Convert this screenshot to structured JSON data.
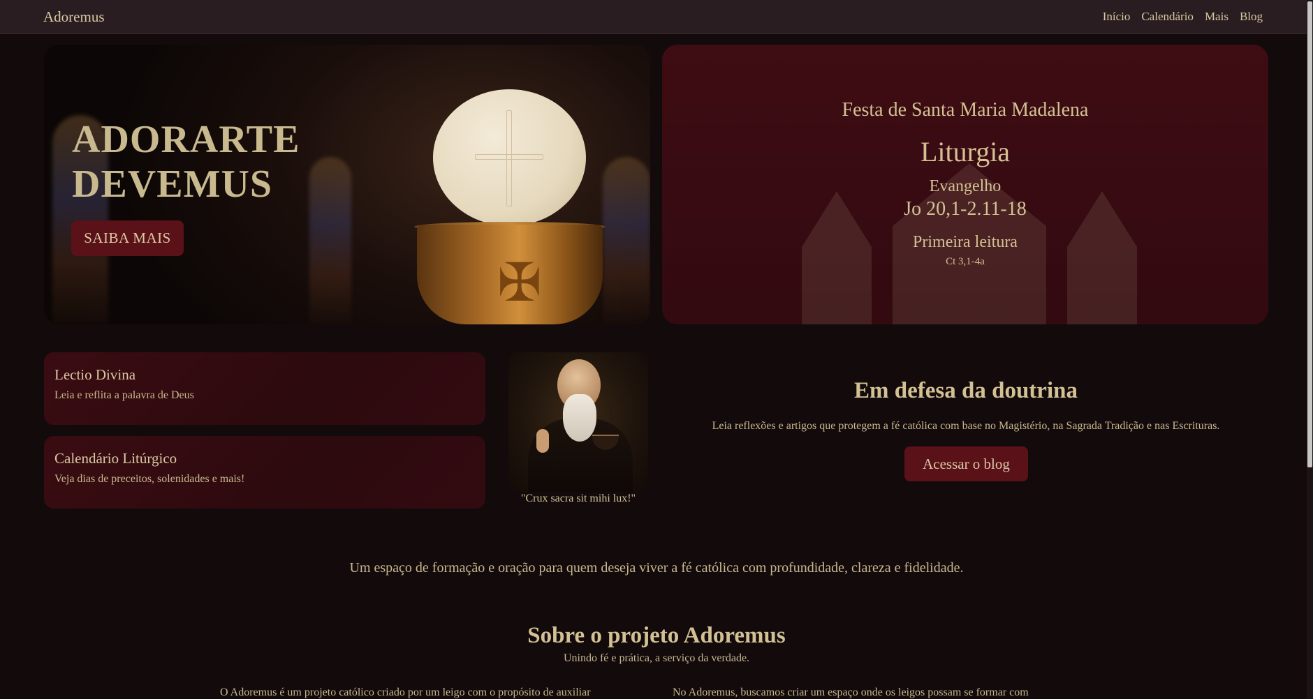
{
  "navbar": {
    "brand": "Adoremus",
    "links": [
      "Início",
      "Calendário",
      "Mais",
      "Blog"
    ]
  },
  "hero": {
    "title": "ADORARTE\nDEVEMUS",
    "button": "SAIBA MAIS"
  },
  "liturgy": {
    "feast": "Festa de Santa Maria Madalena",
    "title": "Liturgia",
    "gospel_label": "Evangelho",
    "gospel_ref": "Jo 20,1-2.11-18",
    "first_reading_label": "Primeira leitura",
    "first_reading_ref": "Ct 3,1-4a"
  },
  "cards": [
    {
      "title": "Lectio Divina",
      "description": "Leia e reflita a palavra de Deus"
    },
    {
      "title": "Calendário Litúrgico",
      "description": "Veja dias de preceitos, solenidades e mais!"
    }
  ],
  "saint": {
    "quote": "\"Crux sacra sit mihi lux!\""
  },
  "doctrine": {
    "title": "Em defesa da doutrina",
    "description": "Leia reflexões e artigos que protegem a fé católica com base no Magistério, na Sagrada Tradição e nas Escrituras.",
    "button": "Acessar o blog"
  },
  "tagline": "Um espaço de formação e oração para quem deseja viver a fé católica com profundidade, clareza e fidelidade.",
  "about": {
    "title": "Sobre o projeto Adoremus",
    "subtitle": "Unindo fé e prática, a serviço da verdade.",
    "col1": "O Adoremus é um projeto católico criado por um leigo com o propósito de auxiliar",
    "col2": "No Adoremus, buscamos criar um espaço onde os leigos possam se formar com"
  },
  "colors": {
    "background": "#130a0c",
    "navbar": "#2a1d21",
    "accent": "#5a1218",
    "text": "#d9c9a3",
    "card": "#3a0c12"
  }
}
